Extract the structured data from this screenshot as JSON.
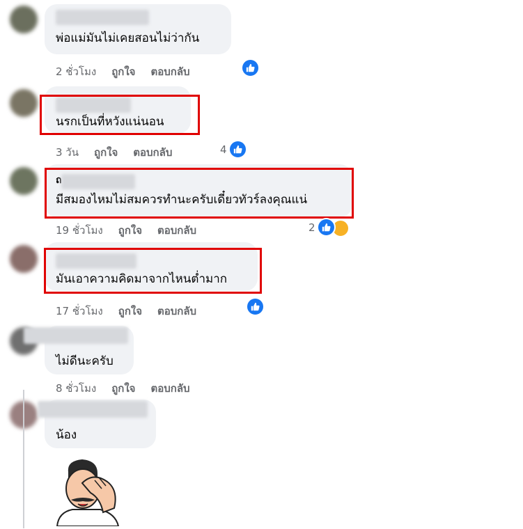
{
  "comments": [
    {
      "text": "พ่อแม่มันไม่เคยสอนไม่ว่ากัน",
      "time": "2 ชั่วโมง",
      "like_label": "ถูกใจ",
      "reply_label": "ตอบกลับ",
      "reaction_count": ""
    },
    {
      "text": "นรกเป็นที่หวังแน่นอน",
      "time": "3 วัน",
      "like_label": "ถูกใจ",
      "reply_label": "ตอบกลับ",
      "reaction_count": "4"
    },
    {
      "name_initial": "ถ",
      "text": "มีสมองไหมไม่สมควรทำนะครับเดี๋ยวทัวร์ลงคุณแน่",
      "time": "19 ชั่วโมง",
      "like_label": "ถูกใจ",
      "reply_label": "ตอบกลับ",
      "reaction_count": "2"
    },
    {
      "text": "มันเอาความคิดมาจากไหนต่ำมาก",
      "time": "17 ชั่วโมง",
      "like_label": "ถูกใจ",
      "reply_label": "ตอบกลับ",
      "reaction_count": ""
    },
    {
      "name_partial": "วนิช สุทธิยา",
      "text": "ไม่ดีนะครับ",
      "time": "8 ชั่วโมง",
      "like_label": "ถูกใจ",
      "reply_label": "ตอบกลับ",
      "reaction_count": ""
    },
    {
      "name_partial": "Chanaphat Pimai",
      "text": "น้อง"
    }
  ],
  "colors": {
    "accent": "#1877f2",
    "highlight": "#e00000",
    "bubble": "#f0f2f5",
    "meta": "#65676b"
  },
  "icons": [
    "like-icon",
    "sad-reaction-icon",
    "facepalm-sticker"
  ]
}
